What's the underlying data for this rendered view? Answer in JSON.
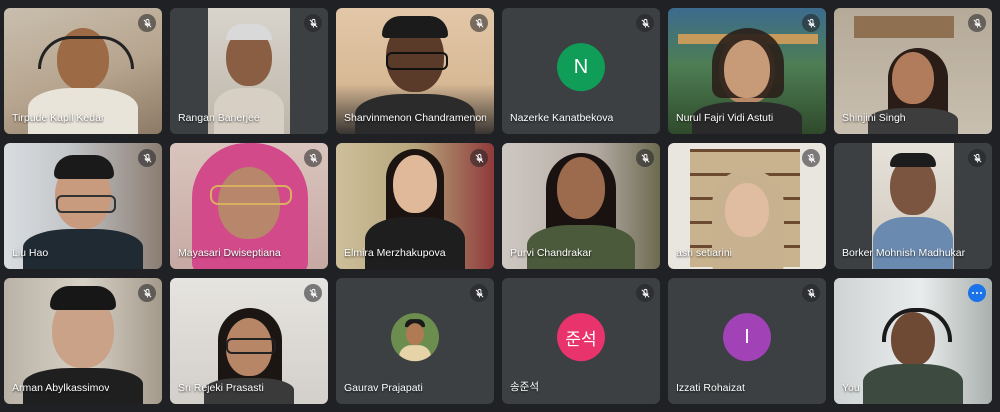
{
  "participants": [
    {
      "name": "Tirpude Kapil Kedar",
      "muted": true
    },
    {
      "name": "Rangan Banerjee",
      "muted": true
    },
    {
      "name": "Sharvinmenon Chandramenon",
      "muted": true
    },
    {
      "name": "Nazerke Kanatbekova",
      "muted": true,
      "avatar_letter": "N",
      "avatar_color": "#0f9d58"
    },
    {
      "name": "Nurul Fajri Vidi Astuti",
      "muted": true
    },
    {
      "name": "Shinjini Singh",
      "muted": true
    },
    {
      "name": "Liu Hao",
      "muted": true
    },
    {
      "name": "Mayasari Dwiseptiana",
      "muted": true
    },
    {
      "name": "Elmira Merzhakupova",
      "muted": true
    },
    {
      "name": "Purvi Chandrakar",
      "muted": true
    },
    {
      "name": "asri setiarini",
      "muted": true
    },
    {
      "name": "Borker Mohnish Madhukar",
      "muted": true
    },
    {
      "name": "Arman Abylkassimov",
      "muted": true
    },
    {
      "name": "Sri Rejeki Prasasti",
      "muted": true
    },
    {
      "name": "Gaurav Prajapati",
      "muted": true
    },
    {
      "name": "송준석",
      "muted": true,
      "avatar_letter": "준석",
      "avatar_color": "#e8336d"
    },
    {
      "name": "Izzati Rohaizat",
      "muted": true,
      "avatar_letter": "I",
      "avatar_color": "#a142b7"
    },
    {
      "name": "You",
      "muted": false
    }
  ],
  "icons": {
    "mute": "mic-off-icon",
    "more": "more-options-icon"
  }
}
